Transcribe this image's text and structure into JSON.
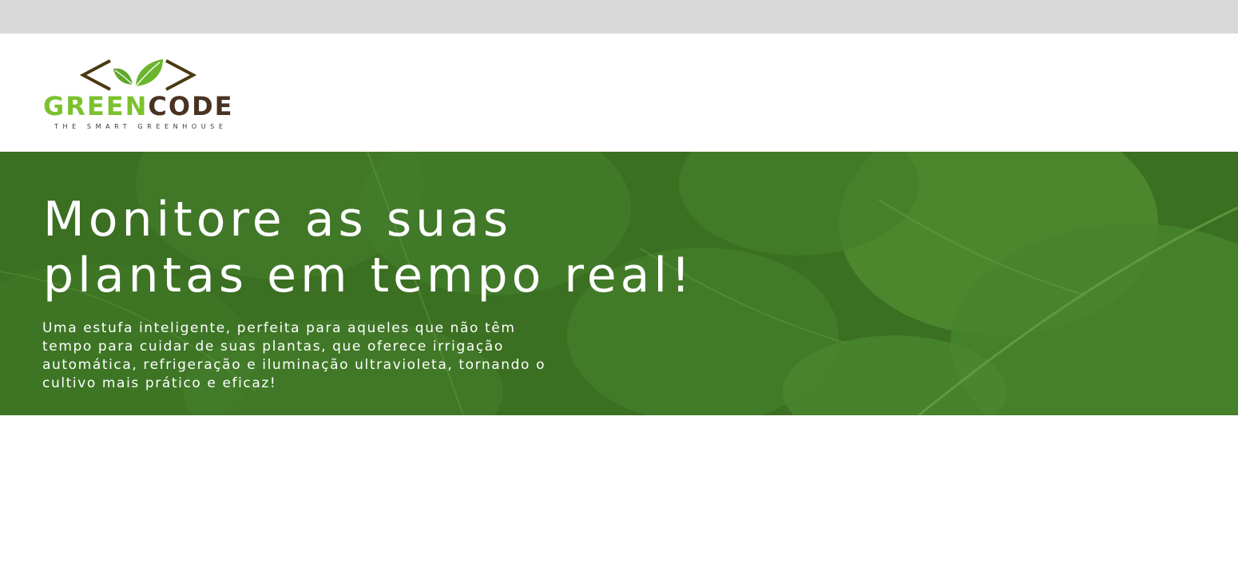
{
  "logo": {
    "word_green": "GREEN",
    "word_brown": "CODE",
    "tagline": "THE SMART GREENHOUSE",
    "icon": "code-brackets-leaves-icon"
  },
  "hero": {
    "title_lines": [
      "Monitore as suas",
      "plantas em tempo real!"
    ],
    "description_lines": [
      "Uma estufa inteligente, perfeita para aqueles que não têm",
      "tempo para cuidar de suas plantas, que oferece irrigação",
      "automática, refrigeração e iluminação ultravioleta, tornando o",
      "cultivo mais prático e eficaz!"
    ],
    "background": "monstera-leaves-image"
  },
  "colors": {
    "topbar": "#d9d9d9",
    "logo_green": "#7cc12f",
    "logo_brown": "#4a3222",
    "hero_green": "#3f7524"
  }
}
